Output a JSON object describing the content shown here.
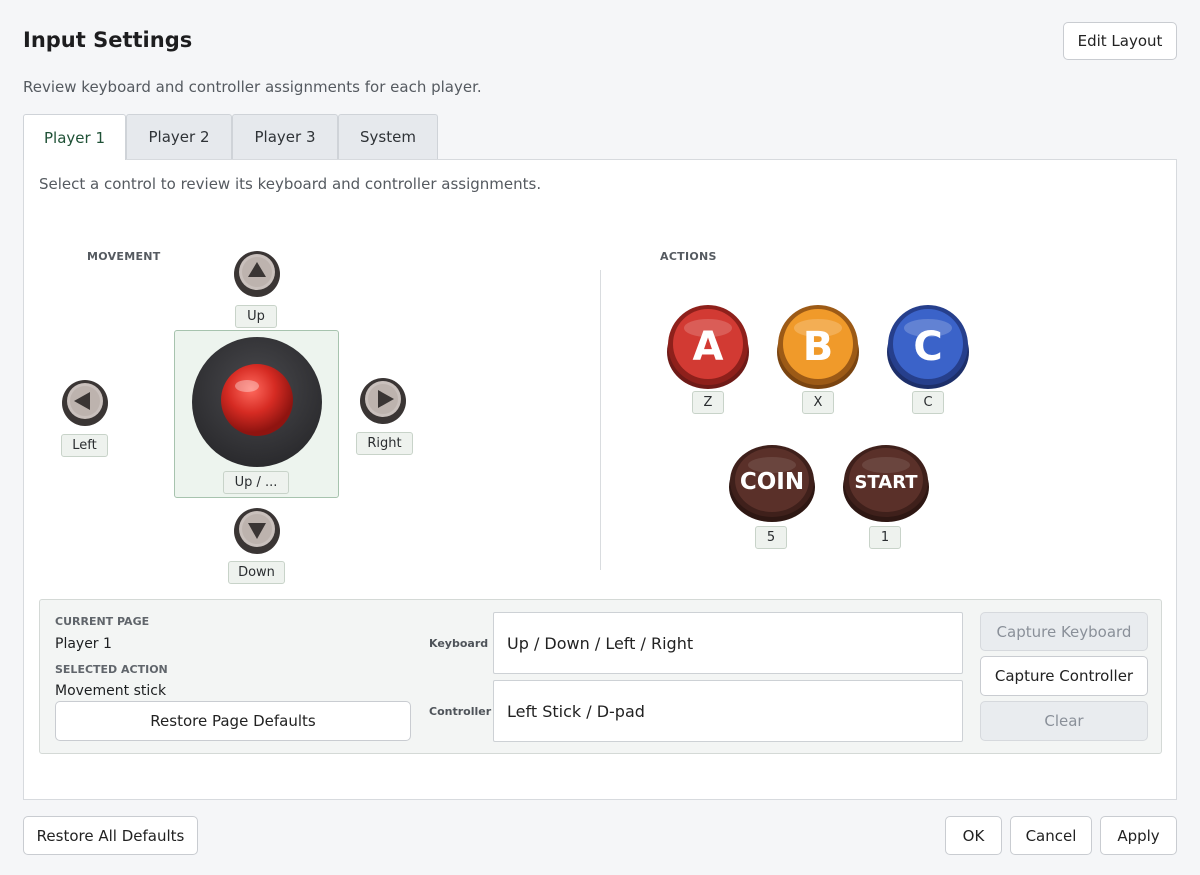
{
  "header": {
    "title": "Input Settings",
    "edit_layout_label": "Edit Layout",
    "subtitle": "Review keyboard and controller assignments for each player."
  },
  "tabs": [
    {
      "label": "Player 1",
      "active": true
    },
    {
      "label": "Player 2",
      "active": false
    },
    {
      "label": "Player 3",
      "active": false
    },
    {
      "label": "System",
      "active": false
    }
  ],
  "panel": {
    "hint": "Select a control to review its keyboard and controller assignments.",
    "movement_label": "MOVEMENT",
    "actions_label": "ACTIONS",
    "movement": {
      "up_key": "Up",
      "down_key": "Down",
      "left_key": "Left",
      "right_key": "Right",
      "stick_key": "Up / ..."
    },
    "actions": [
      {
        "letter": "A",
        "key": "Z",
        "color": "#d23a33"
      },
      {
        "letter": "B",
        "key": "X",
        "color": "#f09a2a"
      },
      {
        "letter": "C",
        "key": "C",
        "color": "#3b63c9"
      },
      {
        "letter": "COIN",
        "key": "5",
        "color": "#5a3029"
      },
      {
        "letter": "START",
        "key": "1",
        "color": "#5a3029"
      }
    ]
  },
  "details": {
    "current_page_label": "CURRENT PAGE",
    "current_page_value": "Player 1",
    "selected_action_label": "SELECTED ACTION",
    "selected_action_value": "Movement stick",
    "restore_page_label": "Restore Page Defaults",
    "keyboard_label": "Keyboard",
    "keyboard_value": "Up / Down / Left / Right",
    "controller_label": "Controller",
    "controller_value": "Left Stick / D-pad",
    "capture_keyboard_label": "Capture Keyboard",
    "capture_controller_label": "Capture Controller",
    "clear_label": "Clear"
  },
  "footer": {
    "restore_all_label": "Restore All Defaults",
    "ok_label": "OK",
    "cancel_label": "Cancel",
    "apply_label": "Apply"
  }
}
